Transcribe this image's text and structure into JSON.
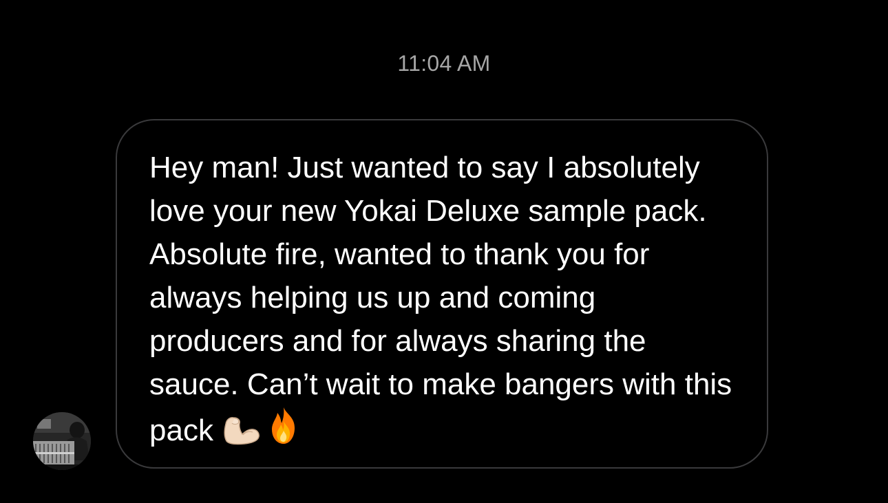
{
  "conversation": {
    "timestamp": "11:04 AM",
    "message": {
      "text": "Hey man! Just wanted to say I absolutely love your new Yokai Deluxe sample pack. Absolute fire, wanted to thank you for always helping us up and coming producers and for always sharing the sauce. Can’t wait to make bangers with this pack",
      "emojis": [
        "flexed-biceps-emoji",
        "fire-emoji"
      ]
    },
    "sender": {
      "avatar": "profile-photo"
    }
  },
  "colors": {
    "background": "#000000",
    "bubble_border": "#3a3a3c",
    "text": "#ffffff",
    "timestamp": "#a6a6a6"
  }
}
